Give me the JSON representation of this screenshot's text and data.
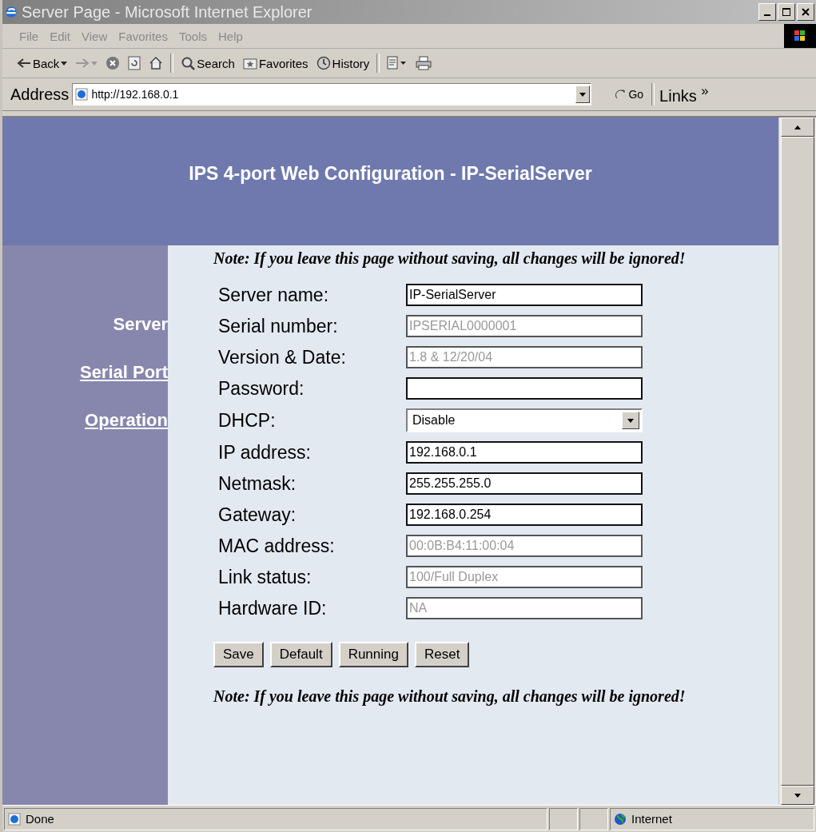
{
  "window": {
    "title": "Server Page - Microsoft Internet Explorer"
  },
  "menu": [
    "File",
    "Edit",
    "View",
    "Favorites",
    "Tools",
    "Help"
  ],
  "toolbar": [
    {
      "kind": "back",
      "label": "Back"
    },
    {
      "kind": "forward"
    },
    {
      "kind": "stop"
    },
    {
      "kind": "refresh"
    },
    {
      "kind": "home"
    },
    {
      "kind": "search",
      "label": "Search"
    },
    {
      "kind": "favorites",
      "label": "Favorites"
    },
    {
      "kind": "history",
      "label": "History"
    },
    {
      "kind": "edit"
    },
    {
      "kind": "print"
    }
  ],
  "address_bar": {
    "label": "Address",
    "value": "http://192.168.0.1",
    "go": "Go",
    "links": "Links",
    "more": "»"
  },
  "page": {
    "heading": "IPS 4-port Web Configuration - IP-SerialServer",
    "nav": [
      {
        "label": "Server",
        "selected": true
      },
      {
        "label": "Serial Port",
        "selected": false
      },
      {
        "label": "Operation",
        "selected": false
      }
    ],
    "note_top": "Note: If you leave this page without saving, all changes will be ignored!",
    "fields": [
      {
        "label": "Server name:",
        "kind": "text",
        "value": "IP-SerialServer",
        "disabled": false
      },
      {
        "label": "Serial number:",
        "kind": "text",
        "value": "IPSERIAL0000001",
        "disabled": true
      },
      {
        "label": "Version & Date:",
        "kind": "text",
        "value": "1.8 & 12/20/04",
        "disabled": true
      },
      {
        "label": "Password:",
        "kind": "text",
        "disabled": false
      },
      {
        "label": "DHCP:",
        "kind": "select",
        "value": "Disable",
        "disabled": false
      },
      {
        "label": "IP address:",
        "kind": "text",
        "value": "192.168.0.1",
        "disabled": false
      },
      {
        "label": "Netmask:",
        "kind": "text",
        "value": "255.255.255.0",
        "disabled": false
      },
      {
        "label": "Gateway:",
        "kind": "text",
        "value": "192.168.0.254",
        "disabled": false
      },
      {
        "label": "MAC address:",
        "kind": "text",
        "value": "00:0B:B4:11:00:04",
        "disabled": true
      },
      {
        "label": "Link status:",
        "kind": "text",
        "value": "100/Full Duplex",
        "disabled": true
      },
      {
        "label": "Hardware ID:",
        "kind": "text",
        "value": "NA",
        "disabled": true
      }
    ],
    "buttons": [
      "Save",
      "Default",
      "Running",
      "Reset"
    ],
    "note_bottom": "Note: If you leave this page without saving, all changes will be ignored!"
  },
  "status_bar": {
    "text": "Done",
    "zone": "Internet"
  }
}
